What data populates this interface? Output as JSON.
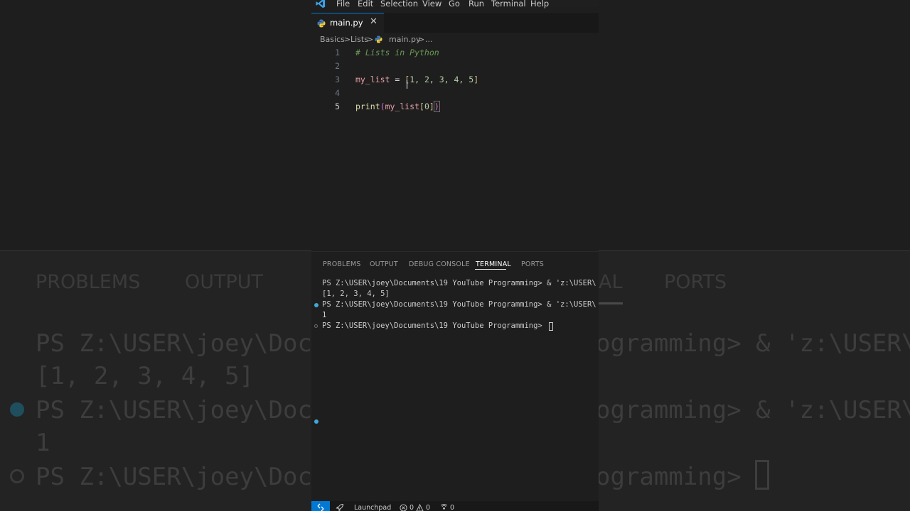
{
  "background": {
    "tabs": [
      "PROBLEMS",
      "OUTPUT",
      "AL",
      "PORTS"
    ],
    "lines_left": [
      "PS Z:\\USER\\joey\\Docu",
      "[1, 2, 3, 4, 5]",
      "PS Z:\\USER\\joey\\Docu",
      "1",
      "PS Z:\\USER\\joey\\Docu"
    ],
    "lines_right": [
      "ogramming> & 'z:\\USER\\",
      "",
      "ogramming> & 'z:\\USER\\",
      "",
      "ogramming> "
    ]
  },
  "menu": {
    "items": [
      "File",
      "Edit",
      "Selection",
      "View",
      "Go",
      "Run",
      "Terminal",
      "Help"
    ]
  },
  "tab": {
    "filename": "main.py",
    "close_glyph": "✕"
  },
  "breadcrumb": {
    "items": [
      "Basics",
      "Lists",
      "main.py",
      "..."
    ],
    "separator": ">"
  },
  "editor": {
    "line_numbers": [
      "1",
      "2",
      "3",
      "4",
      "5"
    ],
    "active_line": 5,
    "comment": "# Lists in Python",
    "line3": {
      "var": "my_list",
      "op": " = ",
      "open": "[",
      "values": "1, 2, 3, 4, 5",
      "close": "]"
    },
    "line5": {
      "fn": "print",
      "open": "(",
      "arg": "my_list",
      "index_open": "[",
      "index": "0",
      "index_close": "]",
      "close": ")"
    }
  },
  "panel": {
    "tabs": [
      "PROBLEMS",
      "OUTPUT",
      "DEBUG CONSOLE",
      "TERMINAL",
      "PORTS"
    ],
    "active_tab": "TERMINAL",
    "terminal_lines": [
      "PS Z:\\USER\\joey\\Documents\\19 YouTube Programming> & 'z:\\USER\\",
      "[1, 2, 3, 4, 5]",
      "PS Z:\\USER\\joey\\Documents\\19 YouTube Programming> & 'z:\\USER\\",
      "1",
      "PS Z:\\USER\\joey\\Documents\\19 YouTube Programming> "
    ]
  },
  "status": {
    "remote_icon": "remote-icon",
    "launchpad": "Launchpad",
    "errors": "0",
    "warnings": "0",
    "ports": "0"
  },
  "colors": {
    "accent": "#0078d4",
    "terminal_dot": "#3fa8d9"
  }
}
